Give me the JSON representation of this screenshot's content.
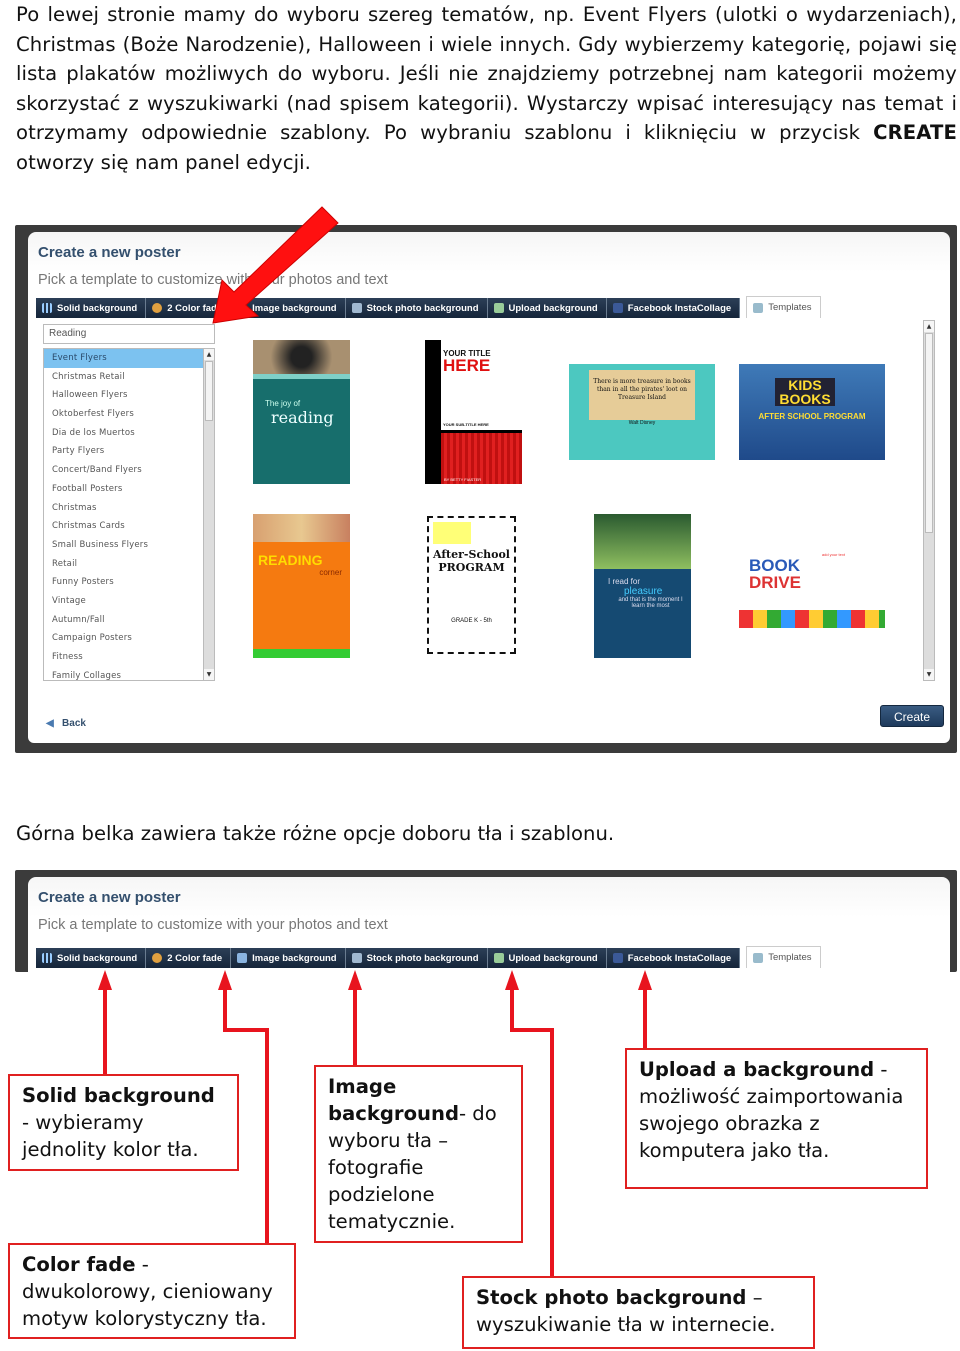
{
  "intro": {
    "text_before": "Po lewej stronie mamy do wyboru szereg tematów, np. Event Flyers (ulotki o wydarzeniach), Christmas (Boże Narodzenie), Halloween i wiele innych. Gdy wybierzemy kategorię, pojawi się lista plakatów możliwych do wyboru. Jeśli nie znajdziemy potrzebnej nam kategorii możemy skorzystać z wyszukiwarki (nad spisem kategorii). Wystarczy wpisać interesujący nas temat i otrzymamy odpowiednie szablony. Po wybraniu szablonu i kliknięciu w przycisk ",
    "bold": "CREATE",
    "text_after": " otworzy się nam panel edycji."
  },
  "app": {
    "title": "Create a new poster",
    "subtitle": "Pick a template to customize with your photos and text",
    "tabs": [
      {
        "label": "Solid background",
        "icon": "grid-icon"
      },
      {
        "label": "2 Color fade",
        "icon": "palette-icon"
      },
      {
        "label": "Image background",
        "icon": "image-icon"
      },
      {
        "label": "Stock photo background",
        "icon": "stock-photo-icon"
      },
      {
        "label": "Upload background",
        "icon": "upload-icon"
      },
      {
        "label": "Facebook InstaCollage",
        "icon": "facebook-icon"
      },
      {
        "label": "Templates",
        "icon": "templates-icon"
      }
    ],
    "search_value": "Reading",
    "categories": [
      "Event Flyers",
      "Christmas Retail",
      "Halloween Flyers",
      "Oktoberfest Flyers",
      "Dia de los Muertos",
      "Party Flyers",
      "Concert/Band Flyers",
      "Football Posters",
      "Christmas",
      "Christmas Cards",
      "Small Business Flyers",
      "Retail",
      "Funny Posters",
      "Vintage",
      "Autumn/Fall",
      "Campaign Posters",
      "Fitness",
      "Family Collages"
    ],
    "selected_category": "Event Flyers",
    "posters": [
      {
        "line1": "The joy of",
        "line2": "reading"
      },
      {
        "line1": "YOUR TITLE",
        "line2": "HERE",
        "line3": "YOUR SUB-TITLE HERE",
        "line4": "BY BETTY FIASTER"
      },
      {
        "line1": "There is more treasure in books than in all the pirates' loot on Treasure Island",
        "line2": "Walt Disney"
      },
      {
        "line1": "KIDS",
        "line2": "BOOKS",
        "line3": "AFTER SCHOOL PROGRAM"
      },
      {
        "line1": "READING",
        "line2": "corner"
      },
      {
        "line1": "After-School",
        "line2": "PROGRAM",
        "line3": "GRADE K - 5th"
      },
      {
        "line1": "I read for",
        "line2": "pleasure",
        "line3": "and that is the moment I learn the most"
      },
      {
        "line1": "add your text",
        "line2": "BOOK",
        "line3": "DRIVE"
      }
    ],
    "back_label": "Back",
    "create_label": "Create"
  },
  "caption": "Górna belka zawiera także różne opcje doboru tła i szablonu.",
  "callouts": {
    "solid": {
      "bold": "Solid background",
      "text": " - wybieramy jednolity kolor tła."
    },
    "fade": {
      "bold": "Color fade",
      "text": " - dwukolorowy, cieniowany motyw kolorystyczny tła."
    },
    "image": {
      "bold": "Image background",
      "text": "- do wyboru tła – fotografie podzielone tematycznie."
    },
    "upload": {
      "bold": "Upload a background",
      "text": " - możliwość zaimportowania swojego obrazka z komputera jako tła."
    },
    "stock": {
      "bold": "Stock photo background",
      "text": " – wyszukiwanie tła w internecie."
    }
  },
  "colors": {
    "annotation_red": "#e8141e",
    "toolbar_navy": "#1c2d44",
    "selected_category": "#7cc2f0",
    "title_blue": "#34506e"
  }
}
